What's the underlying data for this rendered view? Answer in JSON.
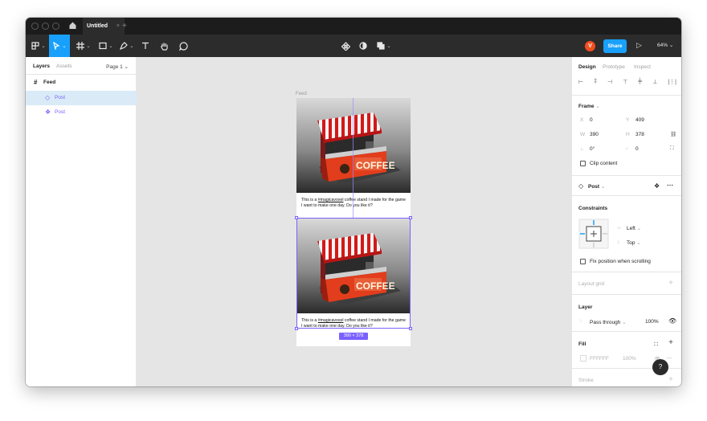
{
  "titlebar": {
    "tab_title": "Untitled",
    "tab_close": "×",
    "tab_add": "+"
  },
  "toolbar": {
    "tools": [
      "main-menu-icon",
      "move-icon",
      "frame-icon",
      "shape-icon",
      "pen-icon",
      "text-icon",
      "hand-icon",
      "comment-icon"
    ],
    "center_tools": [
      "component-icon",
      "mask-icon",
      "boolean-icon"
    ],
    "avatar_initial": "V",
    "share_label": "Share",
    "zoom": "64%",
    "accent": "#18a0fb"
  },
  "left_panel": {
    "tabs": {
      "layers": "Layers",
      "assets": "Assets",
      "page": "Page 1"
    },
    "layers": [
      {
        "name": "Feed",
        "icon": "#",
        "type": "frame"
      },
      {
        "name": "Post",
        "icon": "◇",
        "type": "instance",
        "selected": true
      },
      {
        "name": "Post",
        "icon": "❖",
        "type": "component"
      }
    ]
  },
  "canvas": {
    "frame_label": "Feed",
    "posts": [
      {
        "text_before": "This is a ",
        "hashtag": "#magicavoxel",
        "text_after": " coffee stand I made for the game I want to make one day. Do you like it?",
        "sign": "COFFEE"
      },
      {
        "text_before": "This is a ",
        "hashtag": "#magicavoxel",
        "text_after": " coffee stand I made for the game I want to make one day. Do you like it?",
        "sign": "COFFEE"
      }
    ],
    "dimension_badge": "390 × 378",
    "selection_color": "#7b61ff"
  },
  "right_panel": {
    "tabs": {
      "design": "Design",
      "prototype": "Prototype",
      "inspect": "Inspect"
    },
    "frame": {
      "title": "Frame",
      "x_label": "X",
      "x": "0",
      "y_label": "Y",
      "y": "409",
      "w_label": "W",
      "w": "390",
      "h_label": "H",
      "h": "378",
      "rotation": "0°",
      "radius": "0",
      "clip_content": "Clip content"
    },
    "component": {
      "name": "Post"
    },
    "constraints": {
      "title": "Constraints",
      "horizontal": "Left",
      "vertical": "Top",
      "fix_position": "Fix position when scrolling"
    },
    "layout_grid": {
      "title": "Layout grid"
    },
    "layer": {
      "title": "Layer",
      "blend": "Pass through",
      "opacity": "100%"
    },
    "fill": {
      "title": "Fill",
      "hex": "FFFFFF",
      "opacity": "100%"
    },
    "stroke": {
      "title": "Stroke"
    },
    "help": "?"
  }
}
